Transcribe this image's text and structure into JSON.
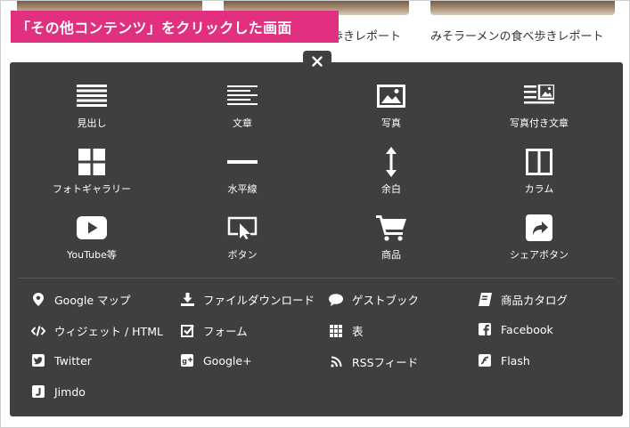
{
  "background": {
    "captions": [
      "歩きレポート",
      "みそラーメンの食べ歩きレポート"
    ]
  },
  "banner": {
    "text": "「その他コンテンツ」をクリックした画面"
  },
  "panel": {
    "close_icon": "close-icon",
    "grid_items": [
      {
        "label": "見出し",
        "icon": "heading-icon"
      },
      {
        "label": "文章",
        "icon": "text-icon"
      },
      {
        "label": "写真",
        "icon": "image-icon"
      },
      {
        "label": "写真付き文章",
        "icon": "image-text-icon"
      },
      {
        "label": "フォトギャラリー",
        "icon": "gallery-icon"
      },
      {
        "label": "水平線",
        "icon": "horizontal-line-icon"
      },
      {
        "label": "余白",
        "icon": "spacing-icon"
      },
      {
        "label": "カラム",
        "icon": "columns-icon"
      },
      {
        "label": "YouTube等",
        "icon": "play-icon"
      },
      {
        "label": "ボタン",
        "icon": "button-icon"
      },
      {
        "label": "商品",
        "icon": "cart-icon"
      },
      {
        "label": "シェアボタン",
        "icon": "share-icon"
      }
    ],
    "list_items": [
      {
        "label": "Google マップ",
        "icon": "map-pin-icon"
      },
      {
        "label": "ファイルダウンロード",
        "icon": "download-icon"
      },
      {
        "label": "ゲストブック",
        "icon": "speech-bubble-icon"
      },
      {
        "label": "商品カタログ",
        "icon": "book-icon"
      },
      {
        "label": "ウィジェット / HTML",
        "icon": "code-icon"
      },
      {
        "label": "フォーム",
        "icon": "checkbox-icon"
      },
      {
        "label": "表",
        "icon": "table-icon"
      },
      {
        "label": "Facebook",
        "icon": "facebook-icon"
      },
      {
        "label": "Twitter",
        "icon": "twitter-icon"
      },
      {
        "label": "Google+",
        "icon": "google-plus-icon"
      },
      {
        "label": "RSSフィード",
        "icon": "rss-icon"
      },
      {
        "label": "Flash",
        "icon": "flash-icon"
      },
      {
        "label": "Jimdo",
        "icon": "jimdo-icon"
      }
    ]
  },
  "colors": {
    "banner": "#e0307f",
    "panel": "#3f3f3f",
    "text": "#ffffff"
  }
}
